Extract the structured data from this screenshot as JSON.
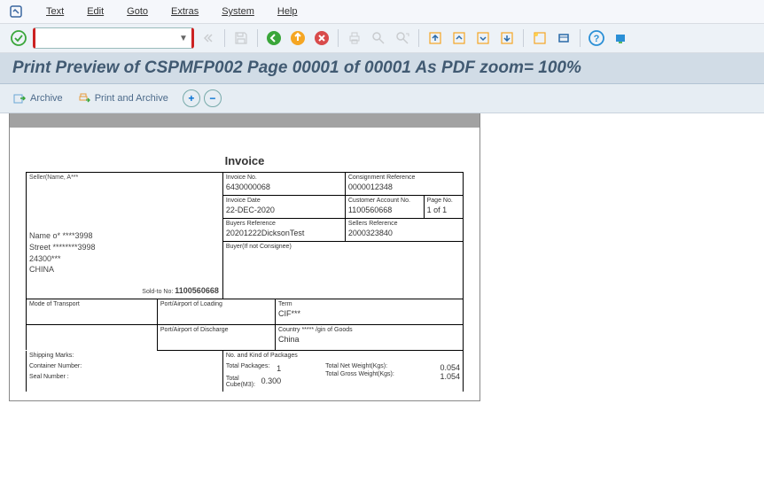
{
  "menu": {
    "text": "Text",
    "edit": "Edit",
    "goto": "Goto",
    "extras": "Extras",
    "system": "System",
    "help": "Help"
  },
  "cmd": {
    "value": "",
    "placeholder": ""
  },
  "title": "Print Preview of CSPMFP002 Page 00001 of 00001 As PDF zoom= 100%",
  "sec": {
    "archive": "Archive",
    "print_archive": "Print and Archive"
  },
  "inv": {
    "heading": "Invoice",
    "seller_label": "Seller(Name, A***",
    "seller_name": "Name o*  ****3998",
    "seller_street": "Street  ********3998",
    "seller_zip": "24300***",
    "seller_country": "CHINA",
    "soldto_label": "Sold-to No:",
    "soldto": "1100560668",
    "invno_label": "Invoice No.",
    "invno": "6430000068",
    "consref_label": "Consignment Reference",
    "consref": "0000012348",
    "invdate_label": "Invoice Date",
    "invdate": "22-DEC-2020",
    "custacc_label": "Customer Account No.",
    "custacc": "1100560668",
    "pageno_label": "Page No.",
    "pageno": "1 of 1",
    "buyref_label": "Buyers Reference",
    "buyref": "20201222DicksonTest",
    "selref_label": "Sellers Reference",
    "selref": "2000323840",
    "buyer_label": "Buyer(If not Consignee)",
    "mot_label": "Mode of Transport",
    "pol_label": "Port/Airport of Loading",
    "term_label": "Term",
    "term": "CIF***",
    "pod_label": "Port/Airport of Discharge",
    "coo_label": "Country ***** /gin of Goods",
    "coo": "China",
    "shipmark_label": "Shipping Marks:",
    "container_label": "Container Number:",
    "seal_label": "Seal Number :",
    "pkgkind_label": "No. and Kind of Packages",
    "totpkg_label": "Total Packages:",
    "totpkg": "1",
    "totcube_label": "Total Cube(M3):",
    "totcube": "0.300",
    "totnet_label": "Total Net Weight(Kgs):",
    "totnet": "0.054",
    "totgross_label": "Total Gross Weight(Kgs):",
    "totgross": "1.054"
  }
}
